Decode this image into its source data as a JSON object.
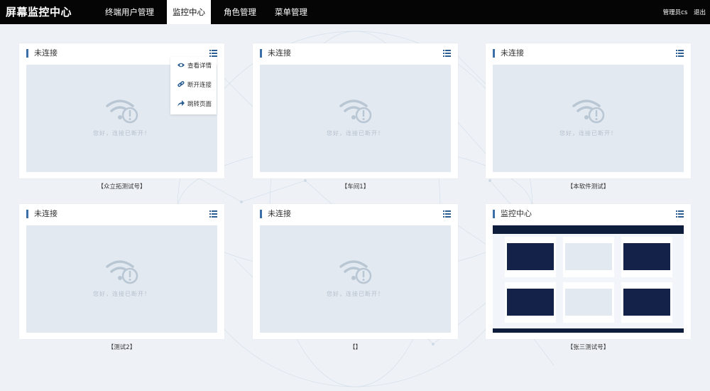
{
  "header": {
    "brand": "屏幕监控中心",
    "nav": [
      {
        "label": "终端用户管理",
        "active": false
      },
      {
        "label": "监控中心",
        "active": true
      },
      {
        "label": "角色管理",
        "active": false
      },
      {
        "label": "菜单管理",
        "active": false
      }
    ],
    "user": "管理员cs",
    "logout": "退出"
  },
  "disconnected_message": "您好，连接已断开！",
  "cards": [
    {
      "title": "未连接",
      "caption": "【众立拓测试号】"
    },
    {
      "title": "未连接",
      "caption": "【车间1】"
    },
    {
      "title": "未连接",
      "caption": "【本软件测试】"
    },
    {
      "title": "未连接",
      "caption": "【测试2】"
    },
    {
      "title": "未连接",
      "caption": "【】"
    },
    {
      "title": "监控中心",
      "caption": "【张三测试号】"
    }
  ],
  "dropdown": {
    "items": [
      {
        "label": "查看详情",
        "icon": "eye-icon"
      },
      {
        "label": "断开连接",
        "icon": "link-icon"
      },
      {
        "label": "跳转页面",
        "icon": "share-icon"
      }
    ]
  },
  "colors": {
    "topbar": "#050505",
    "accent": "#3a6fa8",
    "screen_bg": "#e3e9f0",
    "page_bg": "#eef2f7"
  }
}
